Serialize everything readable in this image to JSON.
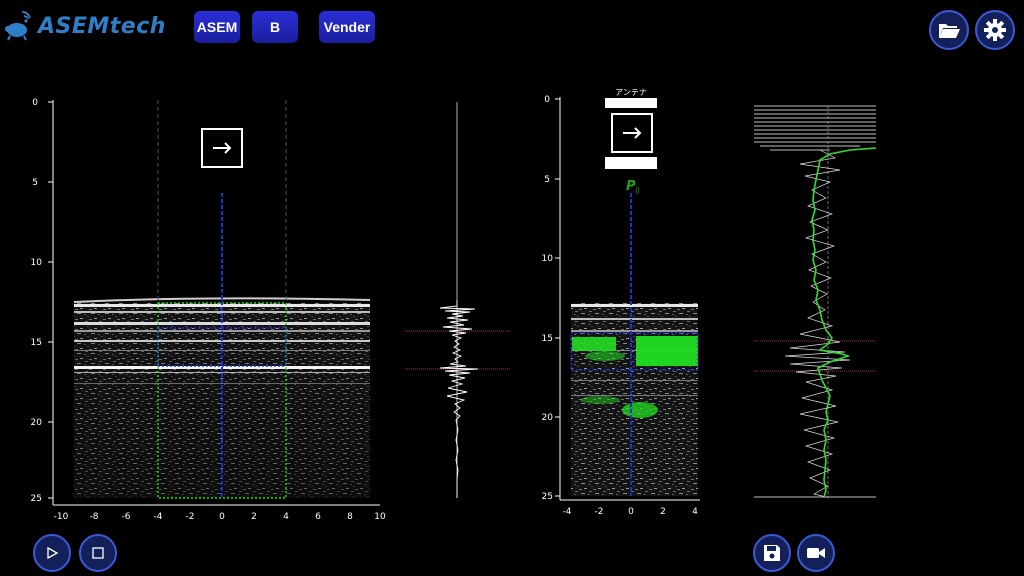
{
  "app": {
    "logo_text": "ASEMtech"
  },
  "toolbar": {
    "btn1": "ASEM",
    "btn2": "B",
    "btn3": "Vender"
  },
  "left_plot": {
    "y_ticks": [
      "0",
      "5",
      "10",
      "15",
      "20",
      "25"
    ],
    "x_ticks": [
      "-10",
      "-8",
      "-6",
      "-4",
      "-2",
      "0",
      "2",
      "4",
      "6",
      "8",
      "10"
    ]
  },
  "right_plot": {
    "antenna_label": "アンテナ",
    "p_label": "P",
    "p_sub": "||",
    "y_ticks": [
      "0",
      "5",
      "10",
      "15",
      "20",
      "25"
    ],
    "x_ticks": [
      "-4",
      "-2",
      "0",
      "2",
      "4"
    ]
  },
  "icons": {
    "folder": "folder-open-icon",
    "settings": "gear-icon",
    "play": "play-icon",
    "stop": "stop-icon",
    "save": "floppy-disk-icon",
    "record": "video-camera-icon"
  },
  "colors": {
    "accent": "#2a2fd8",
    "green": "#22dd22",
    "blue_dash": "#1a2fd8"
  }
}
